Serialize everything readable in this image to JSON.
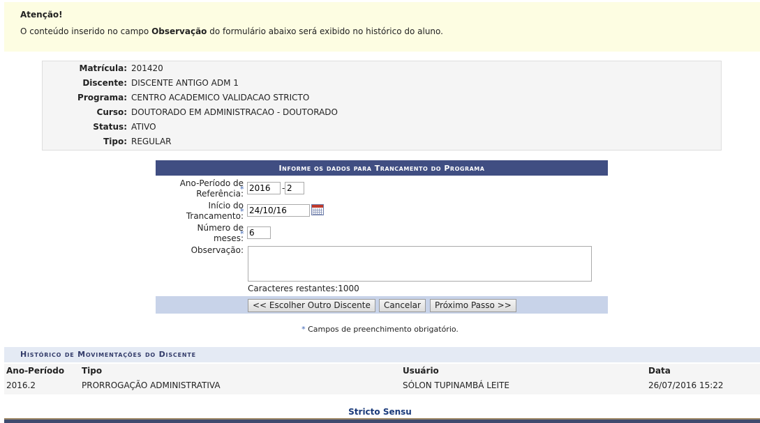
{
  "alert": {
    "title": "Atenção!",
    "msg_before": "O conteúdo inserido no campo ",
    "msg_bold": "Observação",
    "msg_after": " do formulário abaixo será exibido no histórico do aluno."
  },
  "student": {
    "rows": [
      {
        "label": "Matrícula:",
        "value": "201420"
      },
      {
        "label": "Discente:",
        "value": "DISCENTE ANTIGO ADM 1"
      },
      {
        "label": "Programa:",
        "value": "CENTRO ACADEMICO VALIDACAO STRICTO"
      },
      {
        "label": "Curso:",
        "value": "DOUTORADO EM ADMINISTRACAO - DOUTORADO"
      },
      {
        "label": "Status:",
        "value": "ATIVO"
      },
      {
        "label": "Tipo:",
        "value": "REGULAR"
      }
    ]
  },
  "form": {
    "caption": "Informe os dados para Trancamento do Programa",
    "ano_label_1": "Ano-Período de",
    "ano_label_2": "Referência:",
    "ano_value": "2016",
    "ano_sep": "-",
    "periodo_value": "2",
    "inicio_label_1": "Início do",
    "inicio_label_2": "Trancamento:",
    "inicio_value": "24/10/16",
    "meses_label_1": "Número de",
    "meses_label_2": "meses:",
    "meses_value": "6",
    "obs_label": "Observação:",
    "obs_value": "",
    "remaining_label": "Caracteres restantes:",
    "remaining_value": "1000",
    "req_star": "*",
    "btn_back": "<< Escolher Outro Discente",
    "btn_cancel": "Cancelar",
    "btn_next": "Próximo Passo >>"
  },
  "mandatory": {
    "star": "*",
    "text": " Campos de preenchimento obrigatório."
  },
  "history": {
    "caption": "Histórico de Movimentações do Discente",
    "headers": [
      "Ano-Período",
      "Tipo",
      "Usuário",
      "Data"
    ],
    "rows": [
      [
        "2016.2",
        "PRORROGAÇÃO ADMINISTRATIVA",
        "SÓLON TUPINAMBÁ LEITE",
        "26/07/2016 15:22"
      ]
    ]
  },
  "footer": {
    "text": "Stricto Sensu"
  },
  "colors": {
    "caption_bg": "#404e82",
    "alert_bg": "#fdfde2",
    "button_bar": "#c8d3e9",
    "required_star": "#3c64b4"
  }
}
